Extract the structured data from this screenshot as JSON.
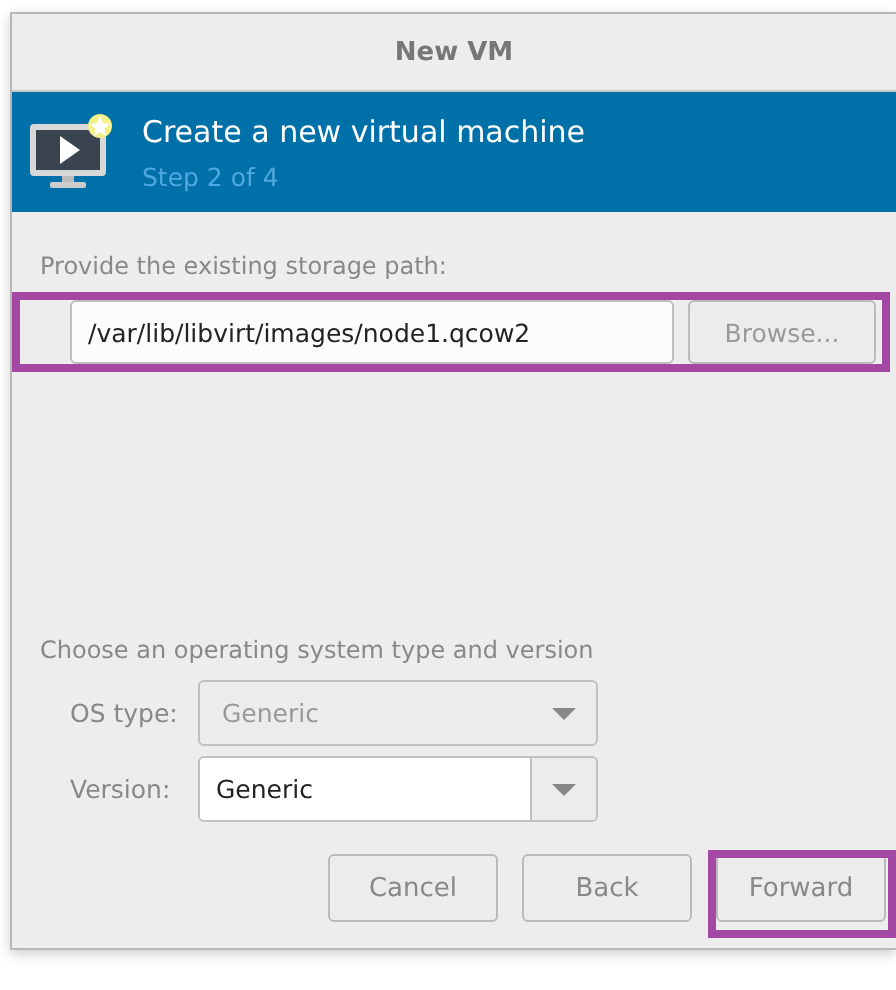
{
  "window": {
    "title": "New VM"
  },
  "header": {
    "title": "Create a new virtual machine",
    "step": "Step 2 of 4"
  },
  "storage": {
    "label": "Provide the existing storage path:",
    "path": "/var/lib/libvirt/images/node1.qcow2",
    "browse": {
      "label": "Browse...",
      "disabled": true
    },
    "highlighted": true
  },
  "os": {
    "label": "Choose an operating system type and version",
    "fields": [
      {
        "label": "OS type:",
        "value": "Generic",
        "kind": "combo",
        "disabled": true
      },
      {
        "label": "Version:",
        "value": "Generic",
        "kind": "entry-combo",
        "disabled": false
      }
    ]
  },
  "buttons": [
    {
      "label": "Cancel",
      "highlighted": false
    },
    {
      "label": "Back",
      "highlighted": false
    },
    {
      "label": "Forward",
      "highlighted": true
    }
  ]
}
